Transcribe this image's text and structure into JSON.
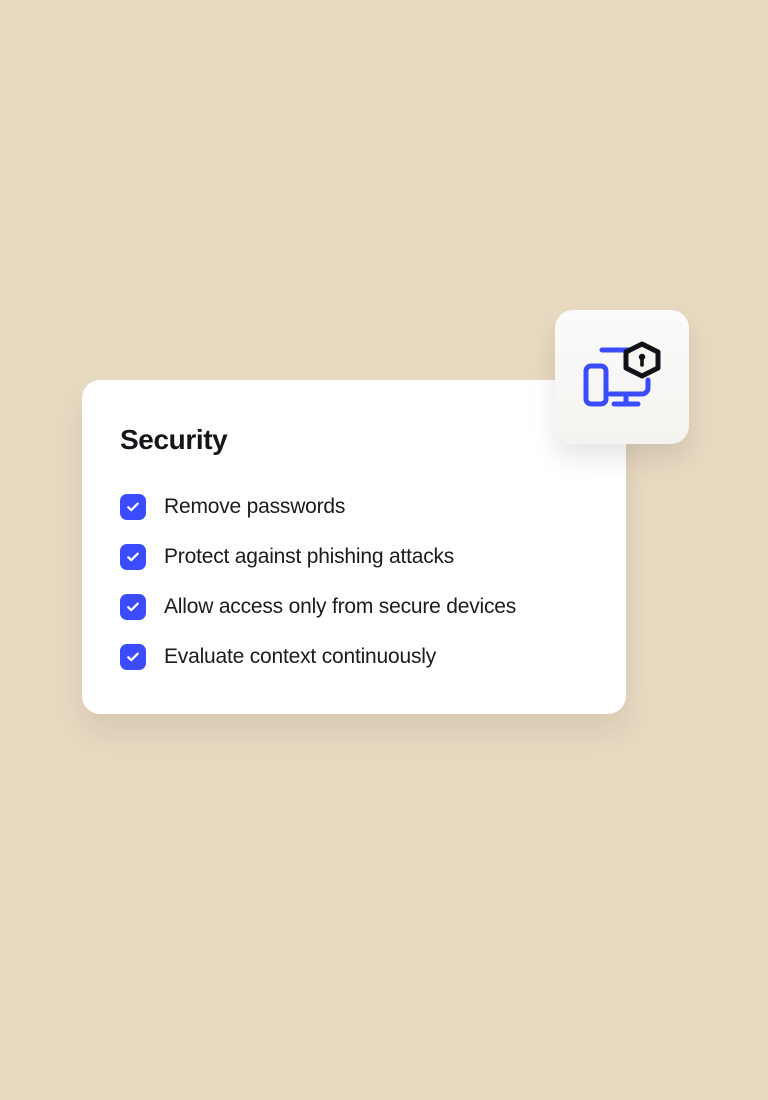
{
  "card": {
    "title": "Security",
    "items": [
      {
        "label": "Remove passwords",
        "checked": true
      },
      {
        "label": "Protect against phishing attacks",
        "checked": true
      },
      {
        "label": "Allow access only from secure devices",
        "checked": true
      },
      {
        "label": "Evaluate context continuously",
        "checked": true
      }
    ]
  },
  "badge": {
    "icon": "secure-devices-icon"
  },
  "colors": {
    "background": "#e8d9c1",
    "cardBg": "#ffffff",
    "accent": "#3b4cff",
    "text": "#16161a"
  }
}
